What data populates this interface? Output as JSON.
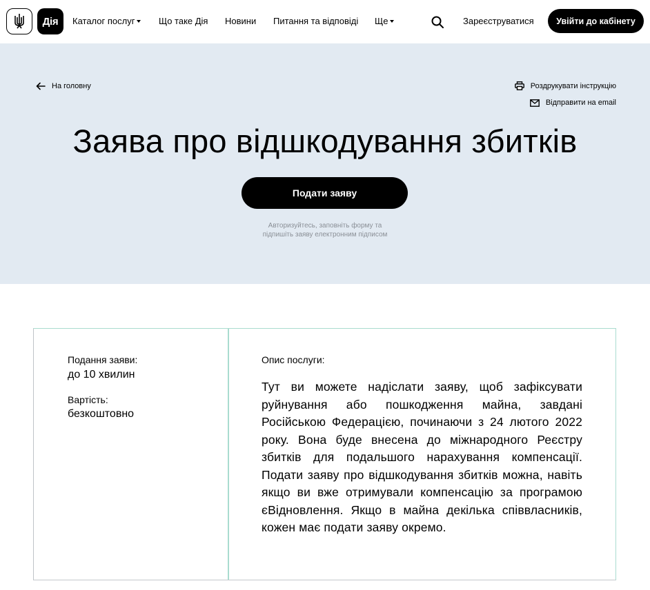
{
  "header": {
    "logo_trident_icon": "trident-icon",
    "logo_text": "Дія",
    "nav": [
      {
        "label": "Каталог послуг",
        "has_dropdown": true
      },
      {
        "label": "Що таке Дія",
        "has_dropdown": false
      },
      {
        "label": "Новини",
        "has_dropdown": false
      },
      {
        "label": "Питання та відповіді",
        "has_dropdown": false
      },
      {
        "label": "Ще",
        "has_dropdown": true
      }
    ],
    "search_icon": "search-icon",
    "register_label": "Зареєструватися",
    "login_label": "Увійти до кабінету"
  },
  "hero": {
    "back_label": "На головну",
    "print_label": "Роздрукувати інструкцію",
    "email_label": "Відправити на email",
    "title": "Заява про відшкодування збитків",
    "apply_label": "Подати заяву",
    "hint_line1": "Авторизуйтесь, заповніть форму та",
    "hint_line2": "підпишіть заяву електронним підписом"
  },
  "service": {
    "duration_label": "Подання заяви:",
    "duration_value": "до 10 хвилин",
    "cost_label": "Вартість:",
    "cost_value": "безкоштовно",
    "description_label": "Опис послуги:",
    "description": "Тут ви можете надіслати заяву, щоб зафіксувати руйнування або пошкодження майна, завдані Російською Федерацією, починаючи з 24 лютого 2022 року. Вона буде внесена до міжнародного Реєстру збитків для подальшого нарахування компенсації. Подати заяву про відшкодування збитків можна, навіть якщо ви вже отримували компенсацію за програмою єВідновлення. Якщо в майна декілька співвласників, кожен має подати заяву окремо."
  },
  "colors": {
    "hero_bg": "#e2eaf2",
    "card_border": "#a9dccf",
    "hint_text": "#8a8f96"
  }
}
